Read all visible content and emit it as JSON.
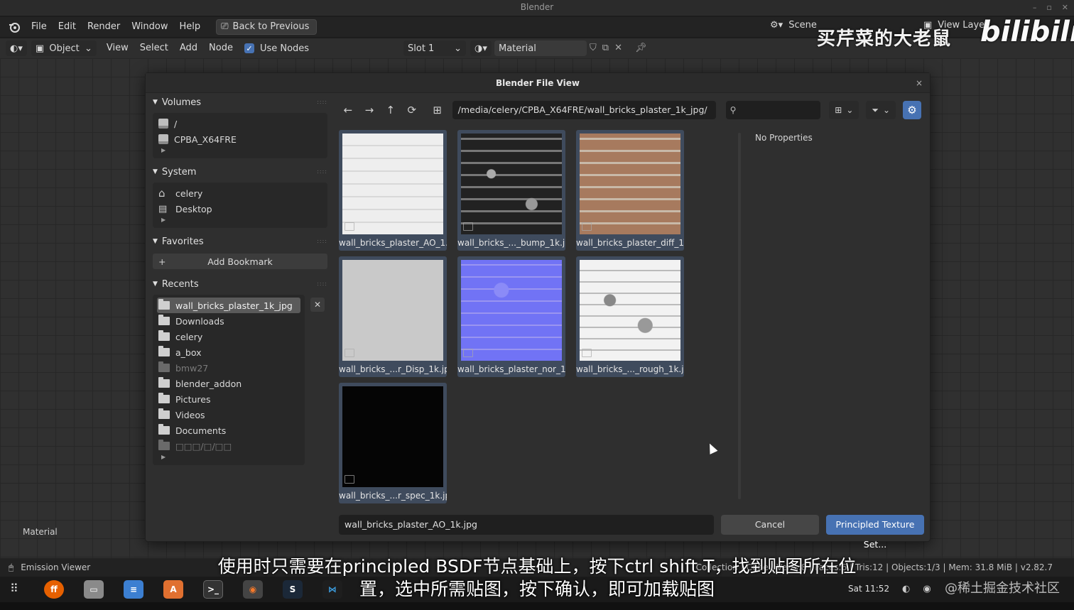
{
  "window": {
    "title": "Blender"
  },
  "menubar": {
    "items": [
      "File",
      "Edit",
      "Render",
      "Window",
      "Help"
    ],
    "back_button": "Back to Previous",
    "scene_label": "Scene",
    "view_layer_label": "View Layer"
  },
  "header2": {
    "mode": "Object",
    "items": [
      "View",
      "Select",
      "Add",
      "Node"
    ],
    "use_nodes_label": "Use Nodes",
    "use_nodes_checked": true,
    "slot": "Slot 1",
    "material": "Material"
  },
  "dialog": {
    "title": "Blender File View",
    "volumes": {
      "title": "Volumes",
      "items": [
        "/",
        "CPBA_X64FRE"
      ]
    },
    "system": {
      "title": "System",
      "items": [
        "celery",
        "Desktop"
      ]
    },
    "favorites": {
      "title": "Favorites",
      "add_bookmark": "Add Bookmark"
    },
    "recents": {
      "title": "Recents",
      "items": [
        {
          "label": "wall_bricks_plaster_1k_jpg",
          "selected": true,
          "dim": false
        },
        {
          "label": "Downloads",
          "selected": false,
          "dim": false
        },
        {
          "label": "celery",
          "selected": false,
          "dim": false
        },
        {
          "label": "a_box",
          "selected": false,
          "dim": false
        },
        {
          "label": "bmw27",
          "selected": false,
          "dim": true
        },
        {
          "label": "blender_addon",
          "selected": false,
          "dim": false
        },
        {
          "label": "Pictures",
          "selected": false,
          "dim": false
        },
        {
          "label": "Videos",
          "selected": false,
          "dim": false
        },
        {
          "label": "Documents",
          "selected": false,
          "dim": false
        },
        {
          "label": "□□□/□/□□",
          "selected": false,
          "dim": true
        }
      ]
    },
    "path": "/media/celery/CPBA_X64FRE/wall_bricks_plaster_1k_jpg/",
    "files": [
      {
        "name": "wall_bricks_plaster_AO_1...",
        "kind": "ao"
      },
      {
        "name": "wall_bricks_..._bump_1k.jpg",
        "kind": "bump"
      },
      {
        "name": "wall_bricks_plaster_diff_1...",
        "kind": "diff"
      },
      {
        "name": "wall_bricks_...r_Disp_1k.jpg",
        "kind": "disp"
      },
      {
        "name": "wall_bricks_plaster_nor_1...",
        "kind": "nor"
      },
      {
        "name": "wall_bricks_..._rough_1k.jpg",
        "kind": "rough"
      },
      {
        "name": "wall_bricks_...r_spec_1k.jpg",
        "kind": "spec"
      }
    ],
    "no_properties": "No Properties",
    "filename": "wall_bricks_plaster_AO_1k.jpg",
    "cancel": "Cancel",
    "confirm": "Principled Texture Set..."
  },
  "editor": {
    "label": "Material"
  },
  "statusbar": {
    "left": "Emission Viewer",
    "right": "Collection | Cube | Verts:8 | Faces:6 | Tris:12 | Objects:1/3 | Mem: 31.8 MiB | v2.82.7"
  },
  "taskbar": {
    "clock": "Sat 11:52"
  },
  "overlay": {
    "watermark": "买芹菜的大老鼠",
    "bili": "bilibili",
    "subtitle_line1": "使用时只需要在principled BSDF节点基础上，按下ctrl shift T，找到贴图所在位",
    "subtitle_line2": "置，选中所需贴图，按下确认，即可加载贴图",
    "community": "@稀土掘金技术社区"
  },
  "colors": {
    "accent": "#4772b3",
    "tile_selected": "#3f4b5d"
  }
}
